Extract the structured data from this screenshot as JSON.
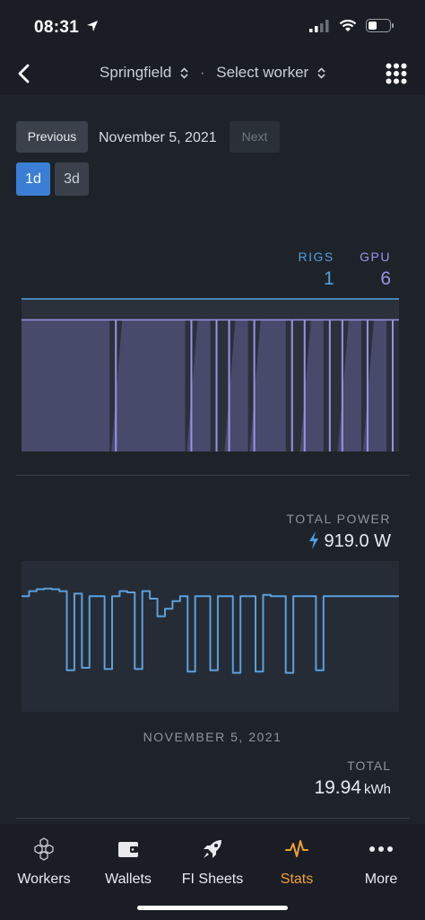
{
  "status": {
    "time": "08:31"
  },
  "nav": {
    "location": "Springfield",
    "separator": "·",
    "worker": "Select worker"
  },
  "date_nav": {
    "previous_label": "Previous",
    "date": "November 5, 2021",
    "next_label": "Next"
  },
  "range": {
    "options": [
      "1d",
      "3d"
    ],
    "selected": "1d"
  },
  "rigs_stats": {
    "rigs_label": "RIGS",
    "rigs_value": "1",
    "gpu_label": "GPU",
    "gpu_value": "6"
  },
  "power": {
    "label": "TOTAL POWER",
    "value": "919.0 W"
  },
  "summary": {
    "date": "NOVEMBER 5, 2021",
    "total_label": "TOTAL",
    "total_value": "19.94",
    "total_unit": "kWh"
  },
  "tabs": [
    {
      "label": "Workers",
      "icon": "honeycomb-icon"
    },
    {
      "label": "Wallets",
      "icon": "wallet-icon"
    },
    {
      "label": "FI Sheets",
      "icon": "rocket-icon"
    },
    {
      "label": "Stats",
      "icon": "pulse-icon",
      "active": true
    },
    {
      "label": "More",
      "icon": "ellipsis-icon"
    }
  ],
  "colors": {
    "accent_blue": "#3a7fd5",
    "rigs_blue": "#4f9fe0",
    "gpu_purple": "#9b92e6",
    "active_tab": "#f0a030"
  },
  "chart_data": [
    {
      "type": "line",
      "title": "",
      "series": [
        {
          "name": "RIGS",
          "values": [
            1,
            1,
            1,
            1,
            1,
            1,
            1,
            1,
            1,
            1,
            1,
            1,
            1,
            1,
            1,
            1,
            1,
            1,
            1,
            1,
            1,
            1,
            1,
            1,
            1,
            1,
            1,
            1,
            1,
            1
          ]
        },
        {
          "name": "GPU",
          "values": [
            6,
            6,
            6,
            6,
            6,
            6,
            6,
            0,
            6,
            6,
            6,
            6,
            6,
            0,
            6,
            0,
            0,
            6,
            0,
            6,
            6,
            0,
            0,
            6,
            0,
            0,
            6,
            0,
            6,
            0
          ]
        }
      ],
      "ylim": [
        0,
        7
      ]
    },
    {
      "type": "line",
      "title": "",
      "ylabel": "",
      "series": [
        {
          "name": "TOTAL POWER",
          "values": [
            920,
            960,
            975,
            980,
            975,
            960,
            330,
            940,
            350,
            920,
            920,
            340,
            920,
            960,
            950,
            340,
            960,
            900,
            760,
            820,
            880,
            920,
            320,
            920,
            920,
            330,
            920,
            920,
            310,
            920,
            920,
            320,
            930,
            920,
            920,
            310,
            920,
            920,
            920,
            330,
            920,
            920,
            920,
            920,
            920,
            920,
            920,
            920,
            920,
            920
          ]
        }
      ],
      "ylim": [
        0,
        1200
      ]
    }
  ]
}
